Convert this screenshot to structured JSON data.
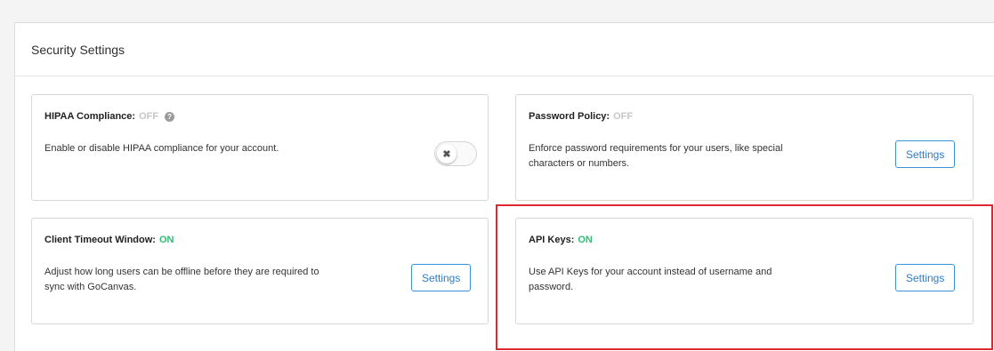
{
  "header": {
    "title": "Security Settings"
  },
  "cards": {
    "hipaa": {
      "title": "HIPAA Compliance:",
      "status": "OFF",
      "help_icon": "question-circle-icon",
      "description": "Enable or disable HIPAA compliance for your account.",
      "toggle_icon": "x-icon",
      "toggle_glyph": "✖",
      "toggle_state": "off"
    },
    "password_policy": {
      "title": "Password Policy:",
      "status": "OFF",
      "description_line1": "Enforce password requirements for your users, like special",
      "description_line2": "characters or numbers.",
      "button_label": "Settings"
    },
    "client_timeout": {
      "title": "Client Timeout Window:",
      "status": "ON",
      "description_line1": "Adjust how long users can be offline before they are required to",
      "description_line2": "sync with GoCanvas.",
      "button_label": "Settings"
    },
    "api_keys": {
      "title": "API Keys:",
      "status": "ON",
      "description_line1": "Use API Keys for your account instead of username and",
      "description_line2": "password.",
      "button_label": "Settings"
    }
  },
  "colors": {
    "status_on": "#2fbf6f",
    "status_off": "#c6c6c6",
    "button_border": "#3a8fd6",
    "highlight": "#e0262e"
  }
}
